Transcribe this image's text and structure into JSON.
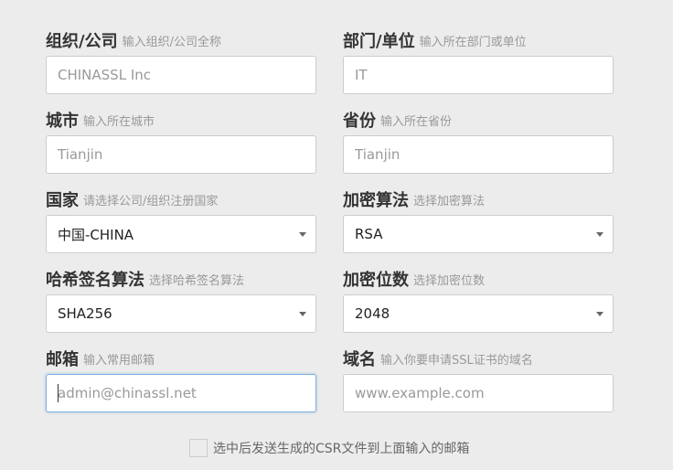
{
  "fields": {
    "org": {
      "label": "组织/公司",
      "hint": "输入组织/公司全称",
      "placeholder": "CHINASSL Inc"
    },
    "dept": {
      "label": "部门/单位",
      "hint": "输入所在部门或单位",
      "placeholder": "IT"
    },
    "city": {
      "label": "城市",
      "hint": "输入所在城市",
      "placeholder": "Tianjin"
    },
    "province": {
      "label": "省份",
      "hint": "输入所在省份",
      "placeholder": "Tianjin"
    },
    "country": {
      "label": "国家",
      "hint": "请选择公司/组织注册国家",
      "value": "中国-CHINA"
    },
    "algorithm": {
      "label": "加密算法",
      "hint": "选择加密算法",
      "value": "RSA"
    },
    "hash": {
      "label": "哈希签名算法",
      "hint": "选择哈希签名算法",
      "value": "SHA256"
    },
    "bits": {
      "label": "加密位数",
      "hint": "选择加密位数",
      "value": "2048"
    },
    "email": {
      "label": "邮箱",
      "hint": "输入常用邮箱",
      "placeholder": "admin@chinassl.net"
    },
    "domain": {
      "label": "域名",
      "hint": "输入你要申请SSL证书的域名",
      "placeholder": "www.example.com"
    }
  },
  "checkbox": {
    "label": "选中后发送生成的CSR文件到上面输入的邮箱",
    "checked": false
  },
  "icons": [
    "chevron-down-icon"
  ]
}
